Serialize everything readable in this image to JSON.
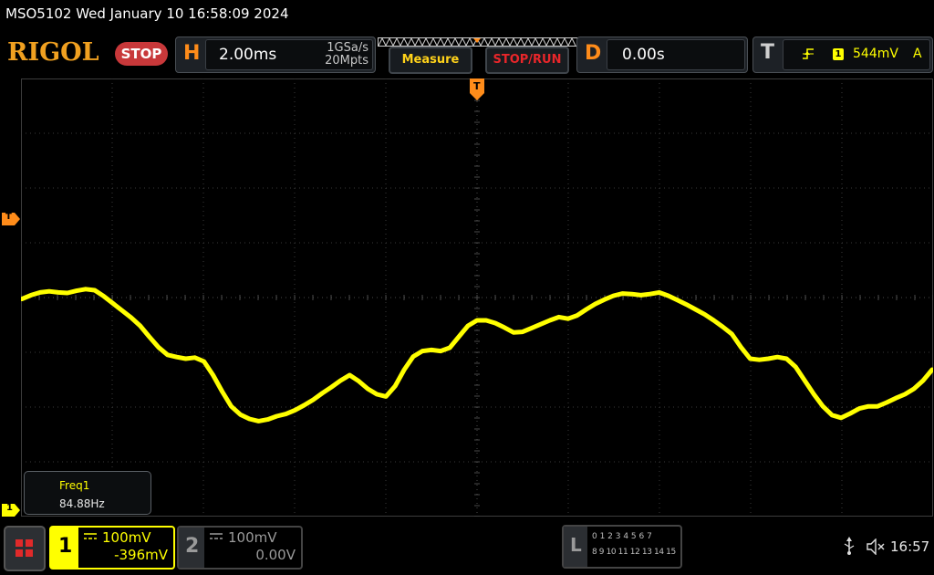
{
  "title": "MSO5102  Wed January 10 16:58:09 2024",
  "brand": "RIGOL",
  "run_state": "STOP",
  "horizontal": {
    "label": "H",
    "timebase": "2.00ms",
    "sample_rate": "1GSa/s",
    "memory_depth": "20Mpts"
  },
  "buttons": {
    "measure": "Measure",
    "stop_run": "STOP/RUN"
  },
  "delay": {
    "label": "D",
    "value": "0.00s"
  },
  "trigger": {
    "label": "T",
    "channel": "1",
    "level": "544mV",
    "mode": "A",
    "marker": "T"
  },
  "measurement": {
    "name": "Freq1",
    "value": "84.88Hz"
  },
  "channel1": {
    "number": "1",
    "scale": "100mV",
    "offset": "-396mV",
    "marker": "1",
    "color": "#ffff00"
  },
  "channel2": {
    "number": "2",
    "scale": "100mV",
    "offset": "0.00V"
  },
  "logic": {
    "label": "L",
    "row1": "0 1 2 3  4 5 6 7",
    "row2": "8 9 10 11 12 13 14 15"
  },
  "status": {
    "time": "16:57"
  },
  "colors": {
    "accent": "#ff8c1a",
    "trace": "#ffff00",
    "stop": "#c8383a",
    "stop_run_text": "#e8262a"
  },
  "waveform_points": [
    [
      0,
      26.4
    ],
    [
      1,
      27.1
    ],
    [
      2,
      27.6
    ],
    [
      3,
      27.8
    ],
    [
      4,
      27.6
    ],
    [
      5,
      27.5
    ],
    [
      6,
      27.9
    ],
    [
      7,
      28.2
    ],
    [
      8,
      28.0
    ],
    [
      9,
      26.9
    ],
    [
      10,
      25.6
    ],
    [
      11,
      24.3
    ],
    [
      12,
      23.0
    ],
    [
      13,
      21.5
    ],
    [
      14,
      19.5
    ],
    [
      15,
      17.6
    ],
    [
      16,
      16.2
    ],
    [
      17,
      15.8
    ],
    [
      18,
      15.5
    ],
    [
      19,
      15.7
    ],
    [
      20,
      15.0
    ],
    [
      21,
      12.5
    ],
    [
      22,
      9.5
    ],
    [
      23,
      6.8
    ],
    [
      24,
      5.3
    ],
    [
      25,
      4.5
    ],
    [
      26,
      4.1
    ],
    [
      27,
      4.4
    ],
    [
      28,
      5.0
    ],
    [
      29,
      5.4
    ],
    [
      30,
      6.1
    ],
    [
      31,
      7.0
    ],
    [
      32,
      8.0
    ],
    [
      33,
      9.2
    ],
    [
      34,
      10.3
    ],
    [
      35,
      11.5
    ],
    [
      36,
      12.5
    ],
    [
      37,
      11.4
    ],
    [
      38,
      10.0
    ],
    [
      39,
      9.0
    ],
    [
      40,
      8.6
    ],
    [
      41,
      10.5
    ],
    [
      42,
      13.5
    ],
    [
      43,
      15.9
    ],
    [
      44,
      16.9
    ],
    [
      45,
      17.1
    ],
    [
      46,
      16.9
    ],
    [
      47,
      17.5
    ],
    [
      48,
      19.5
    ],
    [
      49,
      21.5
    ],
    [
      50,
      22.5
    ],
    [
      51,
      22.5
    ],
    [
      52,
      22.0
    ],
    [
      53,
      21.2
    ],
    [
      54,
      20.3
    ],
    [
      55,
      20.4
    ],
    [
      56,
      21.1
    ],
    [
      57,
      21.8
    ],
    [
      58,
      22.5
    ],
    [
      59,
      23.1
    ],
    [
      60,
      22.8
    ],
    [
      61,
      23.4
    ],
    [
      62,
      24.5
    ],
    [
      63,
      25.5
    ],
    [
      64,
      26.3
    ],
    [
      65,
      27.0
    ],
    [
      66,
      27.4
    ],
    [
      67,
      27.3
    ],
    [
      68,
      27.1
    ],
    [
      69,
      27.3
    ],
    [
      70,
      27.6
    ],
    [
      71,
      27.0
    ],
    [
      72,
      26.2
    ],
    [
      73,
      25.4
    ],
    [
      74,
      24.5
    ],
    [
      75,
      23.6
    ],
    [
      76,
      22.5
    ],
    [
      77,
      21.3
    ],
    [
      78,
      20.0
    ],
    [
      79,
      17.6
    ],
    [
      80,
      15.5
    ],
    [
      81,
      15.3
    ],
    [
      82,
      15.5
    ],
    [
      83,
      15.8
    ],
    [
      84,
      15.5
    ],
    [
      85,
      14.0
    ],
    [
      86,
      11.5
    ],
    [
      87,
      9.0
    ],
    [
      88,
      6.8
    ],
    [
      89,
      5.2
    ],
    [
      90,
      4.7
    ],
    [
      91,
      5.5
    ],
    [
      92,
      6.4
    ],
    [
      93,
      6.8
    ],
    [
      94,
      6.8
    ],
    [
      95,
      7.5
    ],
    [
      96,
      8.3
    ],
    [
      97,
      9.0
    ],
    [
      98,
      10.0
    ],
    [
      99,
      11.5
    ],
    [
      100,
      13.5
    ]
  ]
}
